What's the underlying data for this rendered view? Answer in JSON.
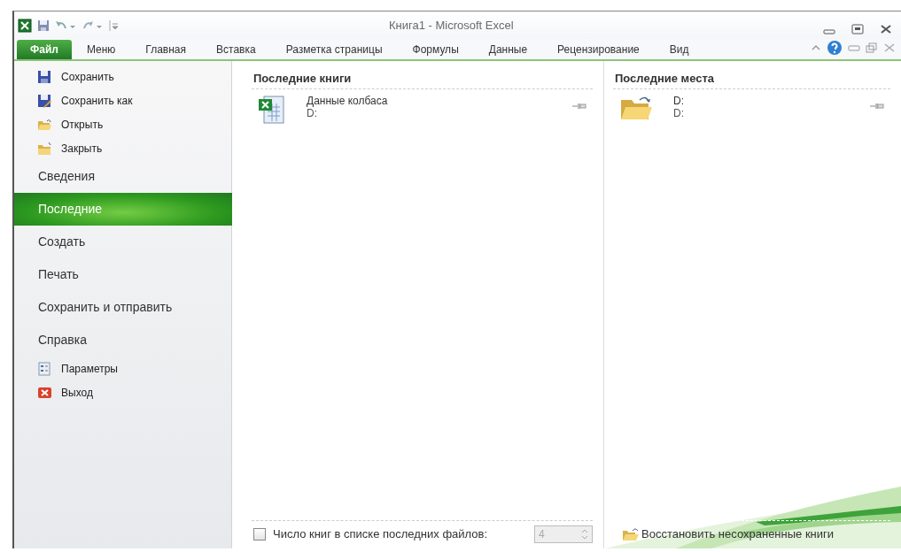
{
  "window": {
    "title": "Книга1 - Microsoft Excel"
  },
  "tabs": [
    {
      "label": "Файл",
      "selected": true
    },
    {
      "label": "Меню",
      "selected": false
    },
    {
      "label": "Главная",
      "selected": false
    },
    {
      "label": "Вставка",
      "selected": false
    },
    {
      "label": "Разметка страницы",
      "selected": false
    },
    {
      "label": "Формулы",
      "selected": false
    },
    {
      "label": "Данные",
      "selected": false
    },
    {
      "label": "Рецензирование",
      "selected": false
    },
    {
      "label": "Вид",
      "selected": false
    }
  ],
  "sidebar": {
    "items": [
      {
        "label": "Сохранить",
        "kind": "command",
        "selected": false
      },
      {
        "label": "Сохранить как",
        "kind": "command",
        "selected": false
      },
      {
        "label": "Открыть",
        "kind": "command",
        "selected": false
      },
      {
        "label": "Закрыть",
        "kind": "command",
        "selected": false
      },
      {
        "label": "Сведения",
        "kind": "section",
        "selected": false
      },
      {
        "label": "Последние",
        "kind": "section",
        "selected": true
      },
      {
        "label": "Создать",
        "kind": "section",
        "selected": false
      },
      {
        "label": "Печать",
        "kind": "section",
        "selected": false
      },
      {
        "label": "Сохранить и отправить",
        "kind": "section",
        "selected": false
      },
      {
        "label": "Справка",
        "kind": "section",
        "selected": false
      },
      {
        "label": "Параметры",
        "kind": "command",
        "selected": false
      },
      {
        "label": "Выход",
        "kind": "command",
        "selected": false
      }
    ]
  },
  "recent_books": {
    "title": "Последние книги",
    "items": [
      {
        "name": "Данные колбаса",
        "path": "D:"
      }
    ]
  },
  "recent_places": {
    "title": "Последние места",
    "items": [
      {
        "name": "D:",
        "path": "D:"
      }
    ]
  },
  "footer": {
    "checkbox": {
      "label": "Число книг в списке последних файлов:",
      "checked": false
    },
    "count": {
      "value": "4",
      "disabled": true
    },
    "recover_link": "Восстановить несохраненные книги"
  }
}
